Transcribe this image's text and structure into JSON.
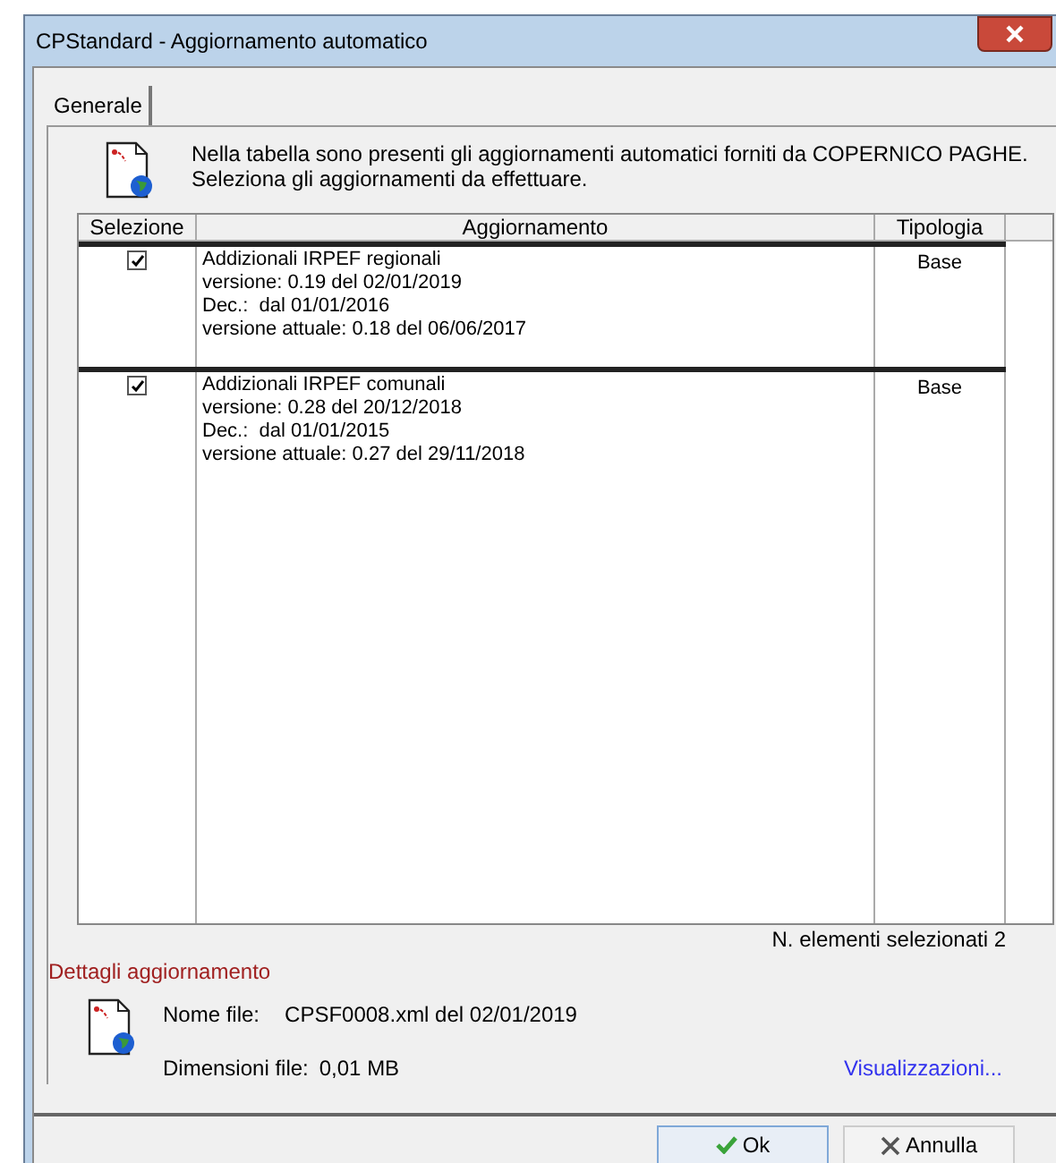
{
  "window": {
    "title": "CPStandard - Aggiornamento automatico"
  },
  "tabs": [
    {
      "label": "Generale",
      "selected": true
    }
  ],
  "intro": [
    "Nella tabella sono presenti gli aggiornamenti automatici forniti da COPERNICO PAGHE.",
    "Seleziona gli aggiornamenti da effettuare."
  ],
  "table": {
    "columns": [
      "Selezione",
      "Aggiornamento",
      "Tipologia"
    ],
    "rows": [
      {
        "checked": true,
        "lines": [
          "Addizionali IRPEF regionali",
          "versione: 0.19 del 02/01/2019",
          "Dec.:  dal 01/01/2016",
          "versione attuale: 0.18 del 06/06/2017"
        ],
        "tipologia": "Base"
      },
      {
        "checked": true,
        "lines": [
          "Addizionali IRPEF comunali",
          "versione: 0.28 del 20/12/2018",
          "Dec.:  dal 01/01/2015",
          "versione attuale: 0.27 del 29/11/2018"
        ],
        "tipologia": "Base"
      }
    ]
  },
  "selected_count": "N. elementi selezionati 2",
  "details": {
    "title": "Dettagli aggiornamento",
    "file_label": "Nome file:",
    "file_value": "CPSF0008.xml del 02/01/2019",
    "size_label": "Dimensioni file:",
    "size_value": "0,01 MB",
    "link": "Visualizzazioni..."
  },
  "buttons": [
    {
      "kind": "ok",
      "label": "Ok"
    },
    {
      "kind": "cancel",
      "label": "Annulla"
    }
  ]
}
